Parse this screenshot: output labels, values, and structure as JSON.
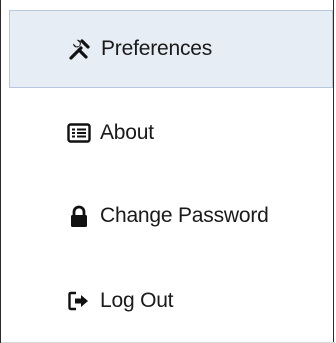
{
  "menu": {
    "items": [
      {
        "label": "Preferences",
        "icon": "tools-icon",
        "active": true
      },
      {
        "label": "About",
        "icon": "list-icon",
        "active": false
      },
      {
        "label": "Change Password",
        "icon": "lock-icon",
        "active": false
      },
      {
        "label": "Log Out",
        "icon": "logout-icon",
        "active": false
      }
    ]
  },
  "colors": {
    "active_background": "#e7edf5",
    "active_border": "#b9c8dc",
    "text": "#1a1a1a",
    "icon": "#111111"
  }
}
